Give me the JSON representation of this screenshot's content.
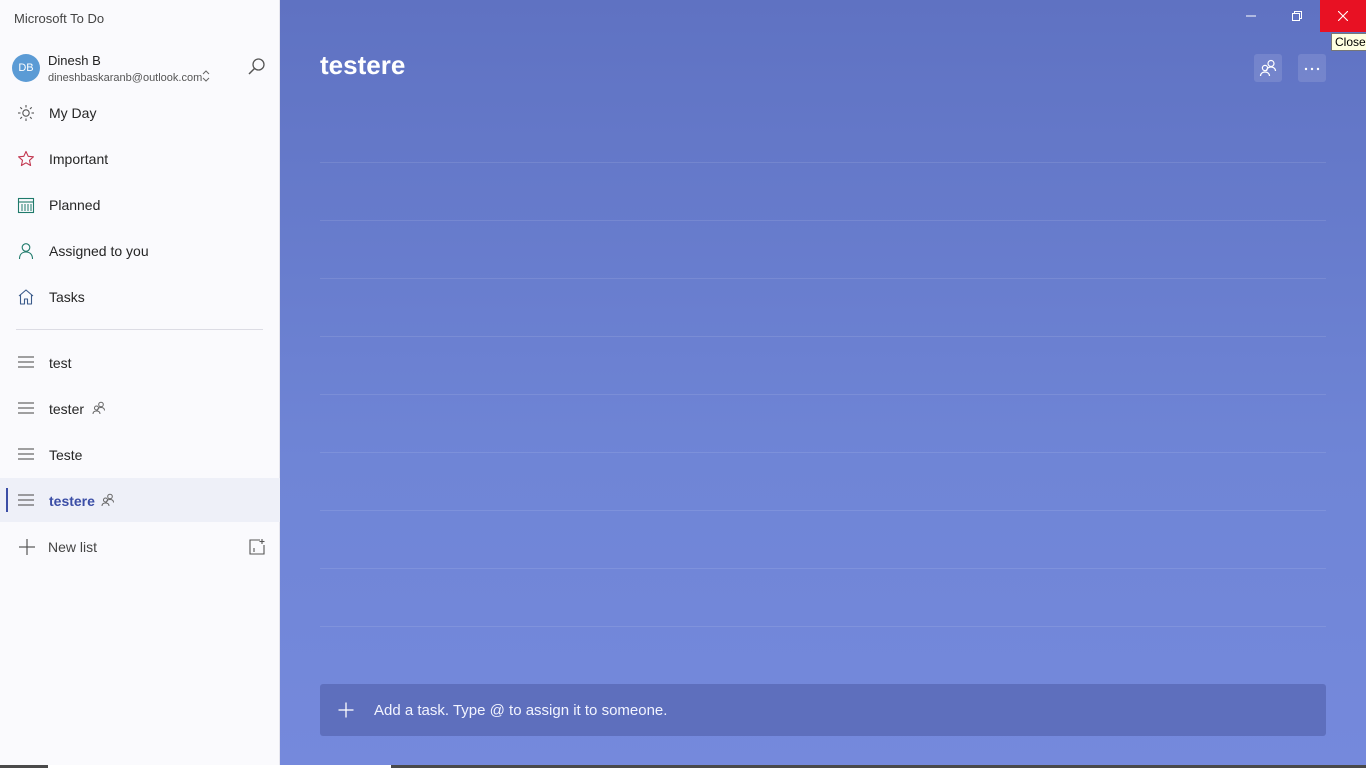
{
  "window": {
    "title": "Microsoft To Do",
    "close_tooltip": "Close"
  },
  "account": {
    "initials": "DB",
    "name": "Dinesh B",
    "email": "dineshbaskaranb@outlook.com"
  },
  "nav": [
    {
      "label": "My Day",
      "icon": "sun-icon"
    },
    {
      "label": "Important",
      "icon": "star-icon"
    },
    {
      "label": "Planned",
      "icon": "calendar-icon"
    },
    {
      "label": "Assigned to you",
      "icon": "person-icon"
    },
    {
      "label": "Tasks",
      "icon": "home-icon"
    }
  ],
  "lists": [
    {
      "label": "test",
      "shared": false,
      "active": false
    },
    {
      "label": "tester",
      "shared": true,
      "active": false
    },
    {
      "label": "Teste",
      "shared": false,
      "active": false
    },
    {
      "label": "testere",
      "shared": true,
      "active": true
    }
  ],
  "new_list": {
    "label": "New list"
  },
  "main": {
    "title": "testere",
    "add_task_placeholder": "Add a task. Type @ to assign it to someone."
  },
  "colors": {
    "accent": "#3b4ea6",
    "background": "#6a7fd0",
    "close": "#e81123"
  }
}
